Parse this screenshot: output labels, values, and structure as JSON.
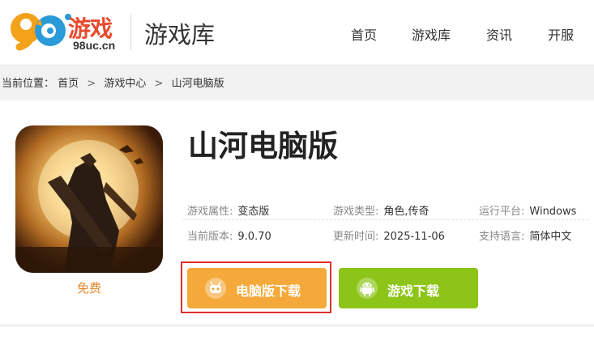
{
  "header": {
    "logo": {
      "number": "98",
      "brand": "游戏",
      "url": "98uc.cn"
    },
    "section_title": "游戏库",
    "nav": [
      "首页",
      "游戏库",
      "资讯",
      "开服"
    ]
  },
  "breadcrumb": {
    "prefix": "当前位置：",
    "items": [
      "首页",
      "游戏中心",
      "山河电脑版"
    ],
    "separator": ">"
  },
  "game": {
    "title": "山河电脑版",
    "price_label": "免费",
    "info": [
      {
        "label": "游戏属性:",
        "value": "变态版"
      },
      {
        "label": "游戏类型:",
        "value": "角色,传奇"
      },
      {
        "label": "运行平台:",
        "value": "Windows"
      },
      {
        "label": "当前版本:",
        "value": "9.0.70"
      },
      {
        "label": "更新时间:",
        "value": "2025-11-06"
      },
      {
        "label": "支持语言:",
        "value": "简体中文"
      }
    ]
  },
  "buttons": {
    "pc_download": "电脑版下载",
    "mobile_download": "游戏下载"
  },
  "colors": {
    "brand_red": "#e84a2e",
    "pc_button": "#f6a93b",
    "android_button": "#8cc417",
    "highlight_border": "#e02e2e",
    "free_text": "#e8872a"
  },
  "icons": {
    "pc_button_icon": "gamepad-robot-icon",
    "mobile_button_icon": "android-icon"
  }
}
